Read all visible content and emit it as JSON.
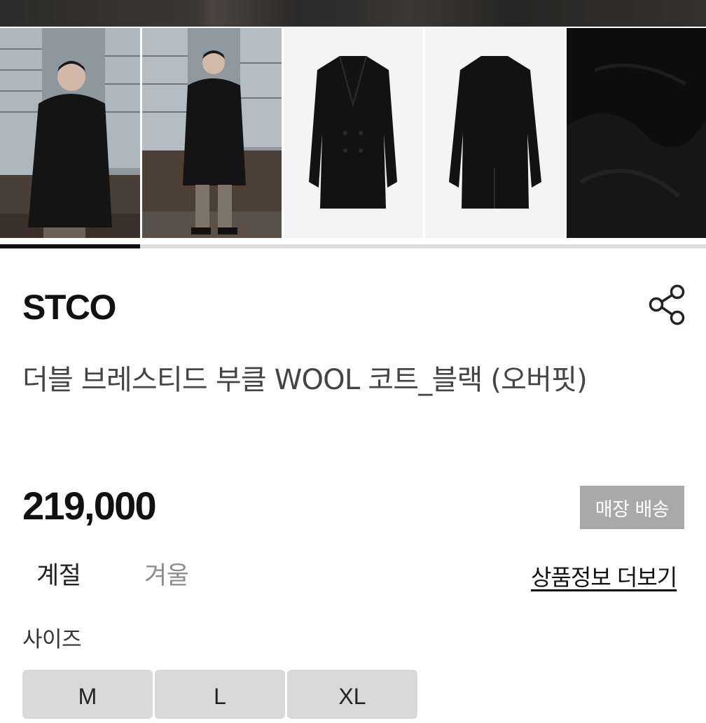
{
  "gallery": {
    "thumbnails": [
      {
        "icon": "model-wearing-coat-photo"
      },
      {
        "icon": "model-full-length-photo"
      },
      {
        "icon": "coat-front-flat-photo"
      },
      {
        "icon": "coat-back-flat-photo"
      },
      {
        "icon": "wool-fabric-closeup-photo"
      }
    ],
    "active_index": 1,
    "total": 5
  },
  "product": {
    "brand": "STCO",
    "title": "더블 브레스티드 부클 WOOL 코트_블랙 (오버핏)",
    "price": "219,000",
    "delivery_badge": "매장 배송"
  },
  "info": {
    "season_label": "계절",
    "season_value": "겨울",
    "more_link": "상품정보 더보기"
  },
  "size": {
    "label": "사이즈",
    "options": [
      "M",
      "L",
      "XL"
    ]
  },
  "colors": {
    "badge_bg": "#a9a9a9",
    "size_button_bg": "#d9d9d9",
    "indicator_active": "#111111"
  },
  "icons": {
    "share": "share-icon"
  }
}
